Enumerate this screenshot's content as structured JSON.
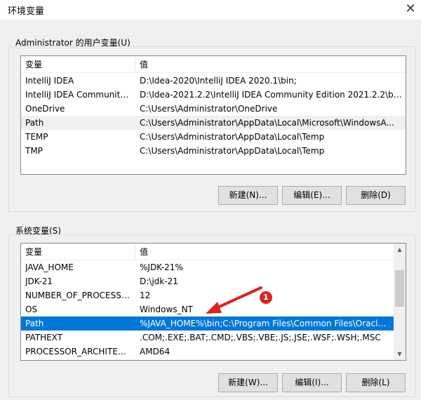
{
  "window": {
    "title": "环境变量",
    "close_glyph": "✕"
  },
  "user_vars": {
    "group_label": "Administrator 的用户变量(U)",
    "columns": {
      "name": "变量",
      "value": "值"
    },
    "rows": [
      {
        "name": "IntelliJ IDEA",
        "value": "D:\\Idea-2020\\IntelliJ IDEA 2020.1\\bin;"
      },
      {
        "name": "IntelliJ IDEA Community E...",
        "value": "D:\\Idea-2021.2.2\\IntelliJ IDEA Community Edition 2021.2.2\\bin;"
      },
      {
        "name": "OneDrive",
        "value": "C:\\Users\\Administrator\\OneDrive"
      },
      {
        "name": "Path",
        "value": "C:\\Users\\Administrator\\AppData\\Local\\Microsoft\\WindowsA..."
      },
      {
        "name": "TEMP",
        "value": "C:\\Users\\Administrator\\AppData\\Local\\Temp"
      },
      {
        "name": "TMP",
        "value": "C:\\Users\\Administrator\\AppData\\Local\\Temp"
      }
    ],
    "hover_row": "Path",
    "buttons": {
      "new": "新建(N)...",
      "edit": "编辑(E)...",
      "delete": "删除(D)"
    }
  },
  "system_vars": {
    "group_label": "系统变量(S)",
    "columns": {
      "name": "变量",
      "value": "值"
    },
    "rows": [
      {
        "name": "JAVA_HOME",
        "value": "%JDK-21%"
      },
      {
        "name": "JDK-21",
        "value": "D:\\jdk-21"
      },
      {
        "name": "NUMBER_OF_PROCESSORS",
        "value": "12"
      },
      {
        "name": "OS",
        "value": "Windows_NT"
      },
      {
        "name": "Path",
        "value": "%JAVA_HOME%\\bin;C:\\Program Files\\Common Files\\Oracle\\J..."
      },
      {
        "name": "PATHEXT",
        "value": ".COM;.EXE;.BAT;.CMD;.VBS;.VBE;.JS;.JSE;.WSF;.WSH;.MSC"
      },
      {
        "name": "PROCESSOR_ARCHITECT...",
        "value": "AMD64"
      }
    ],
    "selected_row": "Path",
    "scrollbar": {
      "up_glyph": "▲",
      "down_glyph": "▼"
    },
    "buttons": {
      "new": "新建(W)...",
      "edit": "编辑(I)...",
      "delete": "删除(L)"
    }
  },
  "annotation": {
    "badge": "1",
    "color": "#d7261e"
  },
  "colors": {
    "selection": "#0078d7",
    "button_face": "#e1e1e1",
    "window_bg": "#f0f0f0"
  }
}
